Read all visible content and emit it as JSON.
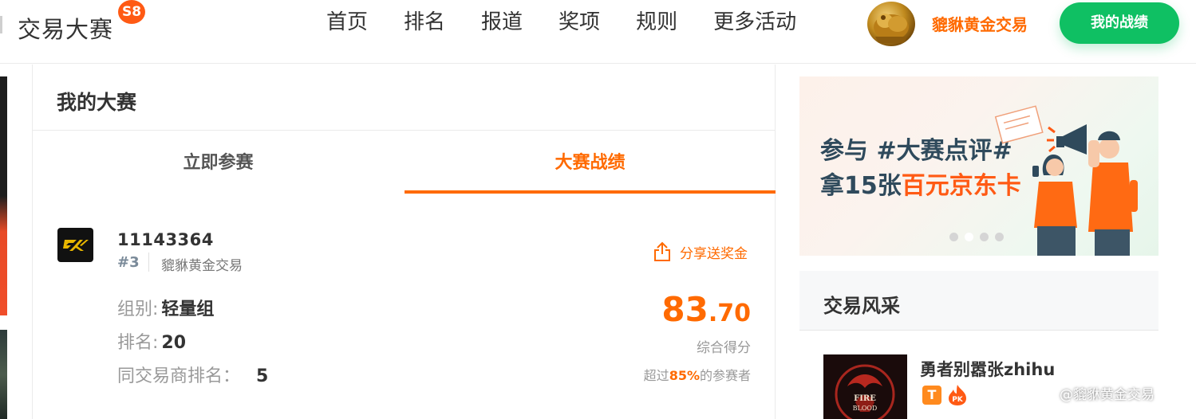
{
  "header": {
    "logo_text": "交易大赛",
    "season_badge": "S8",
    "nav": [
      "首页",
      "排名",
      "报道",
      "奖项",
      "规则",
      "更多活动"
    ],
    "user_name": "貔貅黄金交易",
    "my_performance_button": "我的战绩"
  },
  "panel": {
    "title": "我的大赛",
    "tabs": [
      {
        "label": "立即参赛",
        "active": false
      },
      {
        "label": "大赛战绩",
        "active": true
      }
    ],
    "account_id": "11143364",
    "rank_tag": "#3",
    "broker_name": "貔貅黄金交易",
    "share_label": "分享送奖金",
    "group_label": "组别:",
    "group_value": "轻量组",
    "rank_label": "排名:",
    "rank_value": "20",
    "broker_rank_label": "同交易商排名：",
    "broker_rank_value": "5",
    "score_int": "83",
    "score_dec": ".70",
    "score_label": "综合得分",
    "beat_prefix": "超过",
    "beat_pct": "85%",
    "beat_suffix": "的参赛者"
  },
  "banner": {
    "line1": "参与 #大赛点评#",
    "line2_prefix": "拿15张",
    "line2_highlight": "百元京东卡",
    "dots": 4,
    "active_dot": 1
  },
  "side": {
    "title": "交易风采",
    "trader_name": "勇者别嚣张zhihu",
    "badge_t": "T",
    "badge_pk": "PK",
    "avatar_text": "FIRE BLOOD"
  },
  "watermark": "@貔貅黄金交易",
  "colors": {
    "accent": "#ff6a00",
    "green": "#0fc063",
    "text": "#333333"
  }
}
